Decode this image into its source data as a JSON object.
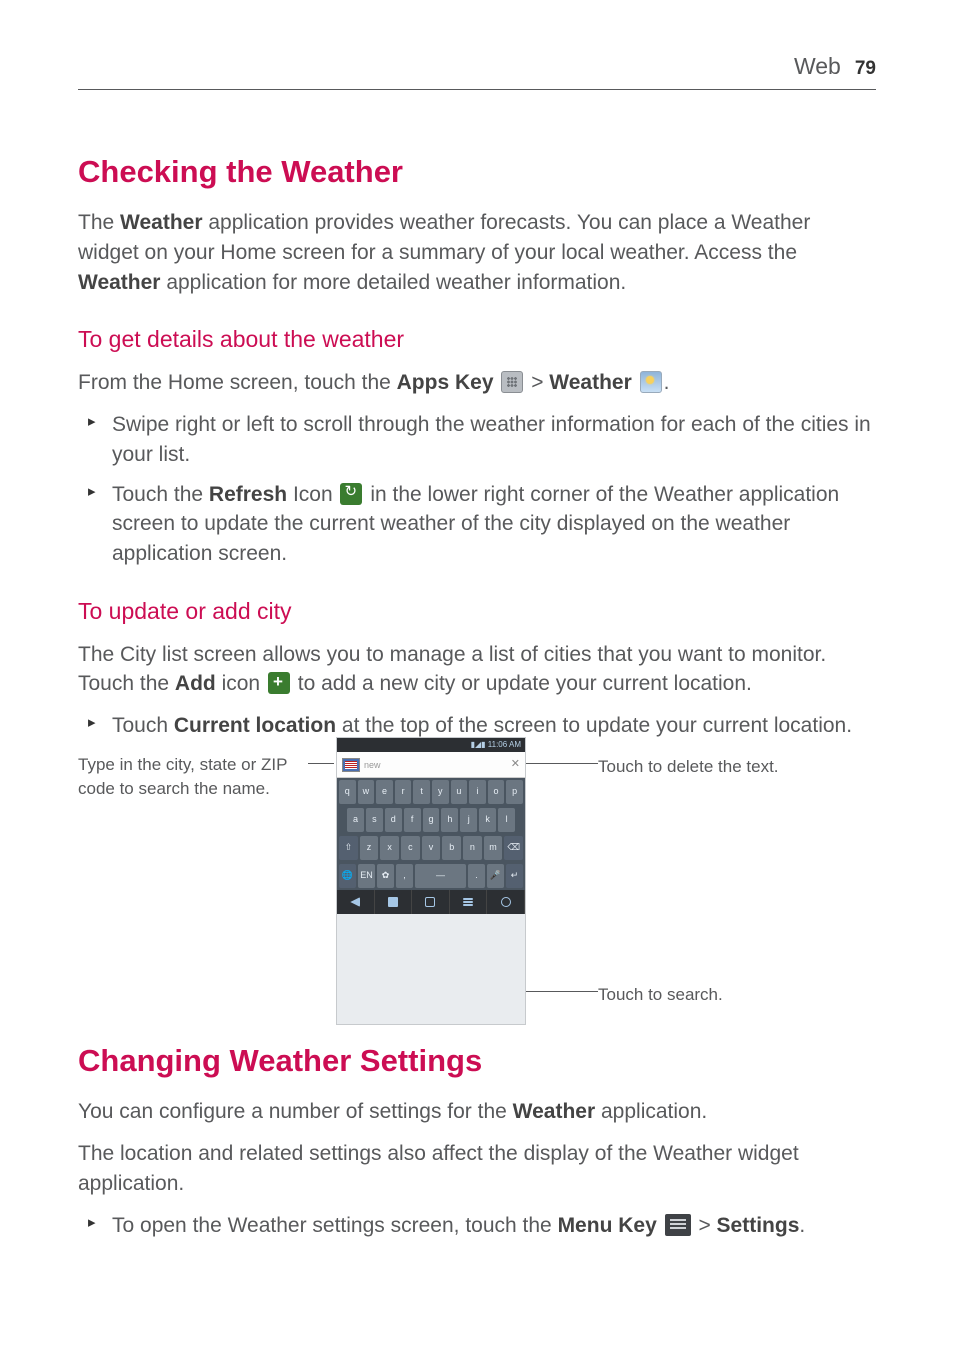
{
  "header": {
    "section": "Web",
    "page": "79"
  },
  "h1a": "Checking the Weather",
  "p_intro_parts": {
    "a": "The ",
    "b": "Weather",
    "c": " application provides weather forecasts. You can place a Weather widget on your Home screen for a summary of your local weather. Access the ",
    "d": "Weather",
    "e": " application for more detailed weather information."
  },
  "h2a": "To get details about the weather",
  "p_from": {
    "a": "From the Home screen, touch the ",
    "b": "Apps Key",
    "c": " > ",
    "d": "Weather",
    "e": "."
  },
  "bullets1": {
    "li1": "Swipe right or left to scroll through the weather information for each of the cities in your list.",
    "li2": {
      "a": "Touch the ",
      "b": "Refresh",
      "c": " Icon ",
      "d": " in the lower right corner of the Weather application screen to update the current weather of the city displayed on the weather application screen."
    }
  },
  "h2b": "To update or add city",
  "p_city": {
    "a": "The City list screen allows you to manage a list of cities that you want to monitor. Touch the ",
    "b": "Add",
    "c": " icon ",
    "d": " to add a new city or update your current location."
  },
  "bullet_current": {
    "a": "Touch ",
    "b": "Current location",
    "c": " at the top of the screen to update your current location."
  },
  "captions": {
    "left": "Type in the city, state or ZIP code to search the name.",
    "right": "Touch to delete the text.",
    "search": "Touch to search."
  },
  "phone": {
    "status_time": "11:06 AM",
    "search_placeholder": "new",
    "kbd_rows": [
      [
        "q",
        "w",
        "e",
        "r",
        "t",
        "y",
        "u",
        "i",
        "o",
        "p"
      ],
      [
        "a",
        "s",
        "d",
        "f",
        "g",
        "h",
        "j",
        "k",
        "l"
      ],
      [
        "⇧",
        "z",
        "x",
        "c",
        "v",
        "b",
        "n",
        "m",
        "⌫"
      ],
      [
        "🌐",
        "EN",
        "✿",
        ",",
        "—",
        ".",
        "🎤",
        "↵"
      ]
    ]
  },
  "h1b": "Changing Weather Settings",
  "p_conf": {
    "a": "You can configure a number of settings for the ",
    "b": "Weather",
    "c": " application."
  },
  "p_loc": "The location and related settings also affect the display of the Weather widget application.",
  "bullet_settings": {
    "a": "To open the Weather settings screen, touch the ",
    "b": "Menu Key",
    "c": " > ",
    "d": "Settings",
    "e": "."
  }
}
